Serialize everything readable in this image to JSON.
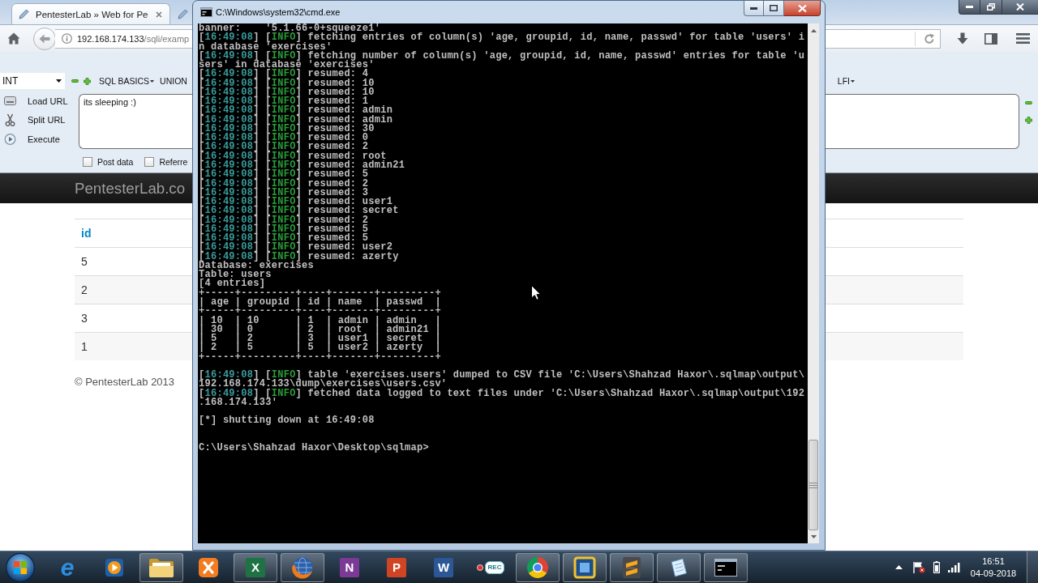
{
  "browser": {
    "tabs": [
      {
        "title": "PentesterLab » Web for Pe",
        "selected": true
      },
      {
        "selected": false
      }
    ],
    "address": {
      "host": "192.168.174.133",
      "path": "/sqli/examp"
    },
    "hackbar": {
      "encoding": "INT",
      "menus": [
        {
          "label": "SQL BASICS",
          "caret": true
        },
        {
          "label": "UNION",
          "caret": false
        }
      ],
      "menus_right": [
        {
          "label": "LFI",
          "caret": true
        }
      ],
      "actions": [
        {
          "kind": "load",
          "label": "Load URL"
        },
        {
          "kind": "split",
          "label": "Split URL"
        },
        {
          "kind": "execute",
          "label": "Execute"
        }
      ],
      "url_text": "its sleeping :)",
      "options": [
        {
          "label": "Post data",
          "checked": false
        },
        {
          "label": "Referre",
          "checked": false
        }
      ]
    },
    "page": {
      "site_title": "PentesterLab.co",
      "table": {
        "columns": [
          "id"
        ],
        "rows": [
          [
            "5"
          ],
          [
            "2"
          ],
          [
            "3"
          ],
          [
            "1"
          ]
        ]
      },
      "footer": "© PentesterLab 2013"
    }
  },
  "terminal": {
    "title": "C:\\Windows\\system32\\cmd.exe",
    "lines": [
      {
        "kind": "text",
        "text": "banner:    '5.1.66-0+squeeze1'"
      },
      {
        "kind": "log",
        "time": "[16:49:08]",
        "level": "[INFO]",
        "message": "fetching entries of column(s) 'age, groupid, id, name, passwd' for table 'users' in database 'exercises'"
      },
      {
        "kind": "log",
        "time": "[16:49:08]",
        "level": "[INFO]",
        "message": "fetching number of column(s) 'age, groupid, id, name, passwd' entries for table 'users' in database 'exercises'"
      },
      {
        "kind": "log",
        "time": "[16:49:08]",
        "level": "[INFO]",
        "message": "resumed: 4"
      },
      {
        "kind": "log",
        "time": "[16:49:08]",
        "level": "[INFO]",
        "message": "resumed: 10"
      },
      {
        "kind": "log",
        "time": "[16:49:08]",
        "level": "[INFO]",
        "message": "resumed: 10"
      },
      {
        "kind": "log",
        "time": "[16:49:08]",
        "level": "[INFO]",
        "message": "resumed: 1"
      },
      {
        "kind": "log",
        "time": "[16:49:08]",
        "level": "[INFO]",
        "message": "resumed: admin"
      },
      {
        "kind": "log",
        "time": "[16:49:08]",
        "level": "[INFO]",
        "message": "resumed: admin"
      },
      {
        "kind": "log",
        "time": "[16:49:08]",
        "level": "[INFO]",
        "message": "resumed: 30"
      },
      {
        "kind": "log",
        "time": "[16:49:08]",
        "level": "[INFO]",
        "message": "resumed: 0"
      },
      {
        "kind": "log",
        "time": "[16:49:08]",
        "level": "[INFO]",
        "message": "resumed: 2"
      },
      {
        "kind": "log",
        "time": "[16:49:08]",
        "level": "[INFO]",
        "message": "resumed: root"
      },
      {
        "kind": "log",
        "time": "[16:49:08]",
        "level": "[INFO]",
        "message": "resumed: admin21"
      },
      {
        "kind": "log",
        "time": "[16:49:08]",
        "level": "[INFO]",
        "message": "resumed: 5"
      },
      {
        "kind": "log",
        "time": "[16:49:08]",
        "level": "[INFO]",
        "message": "resumed: 2"
      },
      {
        "kind": "log",
        "time": "[16:49:08]",
        "level": "[INFO]",
        "message": "resumed: 3"
      },
      {
        "kind": "log",
        "time": "[16:49:08]",
        "level": "[INFO]",
        "message": "resumed: user1"
      },
      {
        "kind": "log",
        "time": "[16:49:08]",
        "level": "[INFO]",
        "message": "resumed: secret"
      },
      {
        "kind": "log",
        "time": "[16:49:08]",
        "level": "[INFO]",
        "message": "resumed: 2"
      },
      {
        "kind": "log",
        "time": "[16:49:08]",
        "level": "[INFO]",
        "message": "resumed: 5"
      },
      {
        "kind": "log",
        "time": "[16:49:08]",
        "level": "[INFO]",
        "message": "resumed: 5"
      },
      {
        "kind": "log",
        "time": "[16:49:08]",
        "level": "[INFO]",
        "message": "resumed: user2"
      },
      {
        "kind": "log",
        "time": "[16:49:08]",
        "level": "[INFO]",
        "message": "resumed: azerty"
      },
      {
        "kind": "text",
        "text": "Database: exercises"
      },
      {
        "kind": "text",
        "text": "Table: users"
      },
      {
        "kind": "text",
        "text": "[4 entries]"
      },
      {
        "kind": "text",
        "text": "+-----+---------+----+-------+---------+"
      },
      {
        "kind": "text",
        "text": "| age | groupid | id | name  | passwd  |"
      },
      {
        "kind": "text",
        "text": "+-----+---------+----+-------+---------+"
      },
      {
        "kind": "text",
        "text": "| 10  | 10      | 1  | admin | admin   |"
      },
      {
        "kind": "text",
        "text": "| 30  | 0       | 2  | root  | admin21 |"
      },
      {
        "kind": "text",
        "text": "| 5   | 2       | 3  | user1 | secret  |"
      },
      {
        "kind": "text",
        "text": "| 2   | 5       | 5  | user2 | azerty  |"
      },
      {
        "kind": "text",
        "text": "+-----+---------+----+-------+---------+"
      },
      {
        "kind": "blank"
      },
      {
        "kind": "log",
        "time": "[16:49:08]",
        "level": "[INFO]",
        "message": "table 'exercises.users' dumped to CSV file 'C:\\Users\\Shahzad Haxor\\.sqlmap\\output\\192.168.174.133\\dump\\exercises\\users.csv'"
      },
      {
        "kind": "log",
        "time": "[16:49:08]",
        "level": "[INFO]",
        "message": "fetched data logged to text files under 'C:\\Users\\Shahzad Haxor\\.sqlmap\\output\\192.168.174.133'"
      },
      {
        "kind": "blank"
      },
      {
        "kind": "text",
        "text": "[*] shutting down at 16:49:08"
      },
      {
        "kind": "blank"
      },
      {
        "kind": "blank"
      },
      {
        "kind": "text",
        "text": "C:\\Users\\Shahzad Haxor\\Desktop\\sqlmap>"
      }
    ]
  },
  "taskbar": {
    "apps": [
      {
        "kind": "ie",
        "glyph": "e",
        "running": false
      },
      {
        "kind": "player",
        "running": false
      },
      {
        "kind": "folder",
        "running": true
      },
      {
        "kind": "xampp",
        "running": false
      },
      {
        "kind": "excel",
        "glyph": "X",
        "running": true
      },
      {
        "kind": "firefox",
        "running": true
      },
      {
        "kind": "onenote",
        "glyph": "N",
        "running": false
      },
      {
        "kind": "powerpoint",
        "glyph": "P",
        "running": false
      },
      {
        "kind": "word",
        "glyph": "W",
        "running": false
      },
      {
        "kind": "recorder",
        "glyph": "REC",
        "running": false
      },
      {
        "kind": "chrome",
        "running": true
      },
      {
        "kind": "vbox",
        "running": true
      },
      {
        "kind": "sublime",
        "running": true
      },
      {
        "kind": "paper",
        "running": true
      },
      {
        "kind": "cmd",
        "running": true
      }
    ],
    "clock": {
      "time": "16:51",
      "date": "04-09-2018"
    }
  }
}
